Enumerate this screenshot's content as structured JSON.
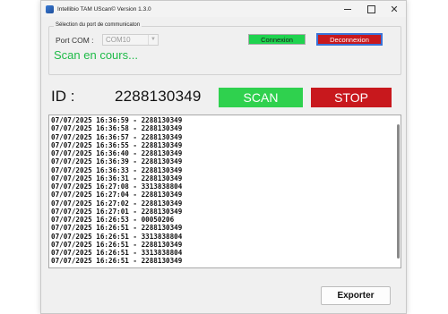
{
  "window": {
    "title": "Intellibio TAM UScan© Version 1.3.0",
    "icon": "app-icon",
    "controls": {
      "minimize": "minimize-icon",
      "maximize": "maximize-icon",
      "close": "✕"
    }
  },
  "connection": {
    "legend": "Sélection du port de communicaton",
    "port_label": "Port COM :",
    "port_value": "COM10",
    "connect_label": "Connexion",
    "disconnect_label": "Deconnexion",
    "status": "Scan en cours..."
  },
  "scan": {
    "id_label": "ID :",
    "id_value": "2288130349",
    "scan_label": "SCAN",
    "stop_label": "STOP"
  },
  "log": [
    "07/07/2025 16:36:59 - 2288130349",
    "07/07/2025 16:36:58 - 2288130349",
    "07/07/2025 16:36:57 - 2288130349",
    "07/07/2025 16:36:55 - 2288130349",
    "07/07/2025 16:36:40 - 2288130349",
    "07/07/2025 16:36:39 - 2288130349",
    "07/07/2025 16:36:33 - 2288130349",
    "07/07/2025 16:36:31 - 2288130349",
    "07/07/2025 16:27:08 - 3313838804",
    "07/07/2025 16:27:04 - 2288130349",
    "07/07/2025 16:27:02 - 2288130349",
    "07/07/2025 16:27:01 - 2288130349",
    "07/07/2025 16:26:53 - 00050206",
    "07/07/2025 16:26:51 - 2288130349",
    "07/07/2025 16:26:51 - 3313838804",
    "07/07/2025 16:26:51 - 2288130349",
    "07/07/2025 16:26:51 - 3313838804",
    "07/07/2025 16:26:51 - 2288130349"
  ],
  "footer": {
    "export_label": "Exporter"
  },
  "colors": {
    "green": "#2fd14e",
    "red": "#c8181d",
    "status_green": "#1fbb48"
  }
}
